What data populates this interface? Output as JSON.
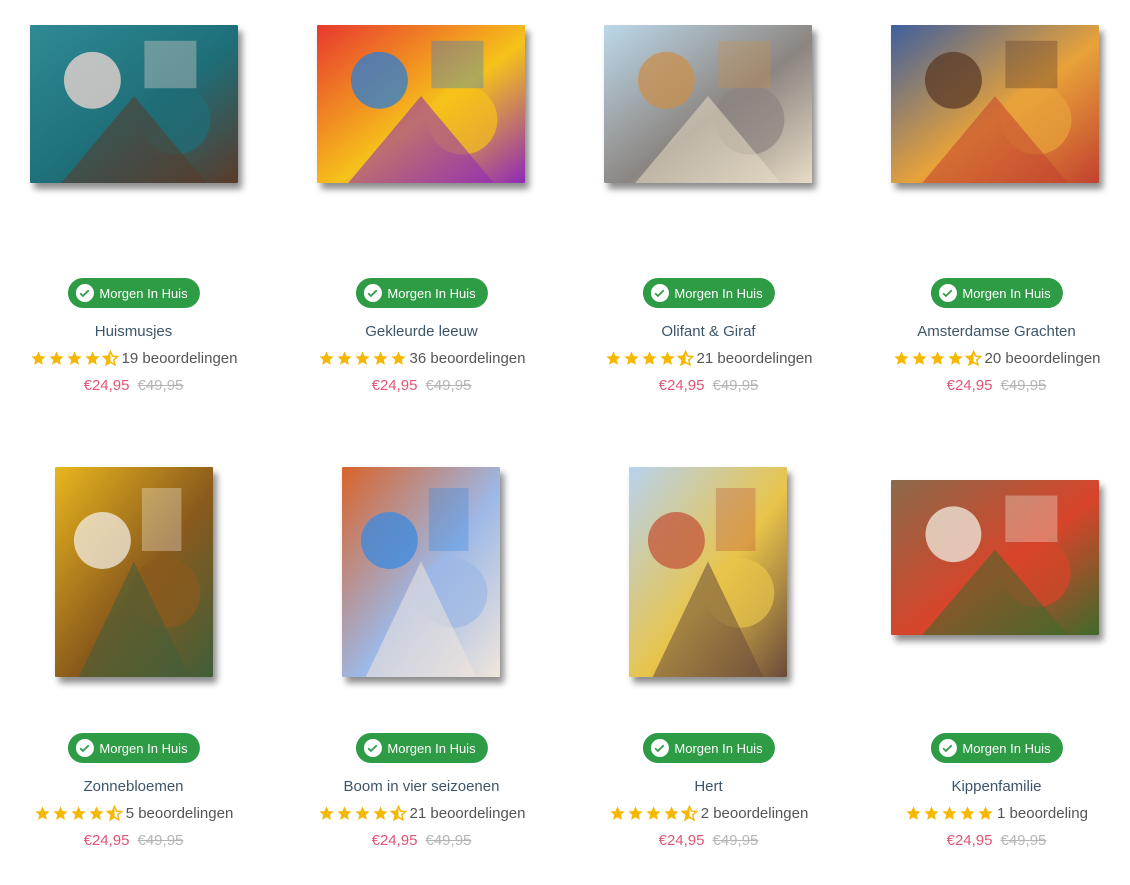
{
  "products": [
    {
      "name": "Huismusjes",
      "badge": "Morgen In Huis",
      "rating": 4.5,
      "reviews": "19 beoordelingen",
      "price": "€24,95",
      "old_price": "€49,95",
      "artwork": "birds-blossom-painting",
      "palette": [
        "#2f8a94",
        "#1e6e78",
        "#f1d9d3",
        "#5a3a2a"
      ]
    },
    {
      "name": "Gekleurde leeuw",
      "badge": "Morgen In Huis",
      "rating": 5,
      "reviews": "36 beoordelingen",
      "price": "€24,95",
      "old_price": "€49,95",
      "artwork": "colorful-lion-painting",
      "palette": [
        "#e8382f",
        "#f6c21a",
        "#2a7fd4",
        "#8e2ab8"
      ]
    },
    {
      "name": "Olifant & Giraf",
      "badge": "Morgen In Huis",
      "rating": 4.5,
      "reviews": "21 beoordelingen",
      "price": "€24,95",
      "old_price": "€49,95",
      "artwork": "elephant-giraffe-painting",
      "palette": [
        "#bcd8ea",
        "#8c8580",
        "#c98f4d",
        "#e8dcc6"
      ]
    },
    {
      "name": "Amsterdamse Grachten",
      "badge": "Morgen In Huis",
      "rating": 4.5,
      "reviews": "20 beoordelingen",
      "price": "€24,95",
      "old_price": "€49,95",
      "artwork": "amsterdam-canal-painting",
      "palette": [
        "#3e5f9e",
        "#e8a23a",
        "#5b3a26",
        "#c2412f"
      ]
    },
    {
      "name": "Zonnebloemen",
      "badge": "Morgen In Huis",
      "rating": 4.5,
      "reviews": "5 beoordelingen",
      "price": "€24,95",
      "old_price": "€49,95",
      "artwork": "sunflowers-painting",
      "palette": [
        "#e9b61e",
        "#8a5a1c",
        "#f1ece0",
        "#3f5e3a"
      ]
    },
    {
      "name": "Boom in vier seizoenen",
      "badge": "Morgen In Huis",
      "rating": 4.5,
      "reviews": "21 beoordelingen",
      "price": "€24,95",
      "old_price": "€49,95",
      "artwork": "four-seasons-tree-painting",
      "palette": [
        "#d9632a",
        "#9db8e6",
        "#3a8ae0",
        "#f0e6dc"
      ]
    },
    {
      "name": "Hert",
      "badge": "Morgen In Huis",
      "rating": 4.5,
      "reviews": "2 beoordelingen",
      "price": "€24,95",
      "old_price": "€49,95",
      "artwork": "geometric-deer-painting",
      "palette": [
        "#b8d2ee",
        "#e8c44a",
        "#c4553a",
        "#6a4a3a"
      ]
    },
    {
      "name": "Kippenfamilie",
      "badge": "Morgen In Huis",
      "rating": 5,
      "reviews": "1 beoordeling",
      "price": "€24,95",
      "old_price": "€49,95",
      "artwork": "chicken-family-painting",
      "palette": [
        "#8a6a4a",
        "#d8442a",
        "#f0ecdf",
        "#3e6a2a"
      ]
    }
  ],
  "colors": {
    "badge_bg": "#2e9b45",
    "title": "#3d5568",
    "price": "#e05575",
    "old_price": "#b5b5b5",
    "star": "#f5b700"
  }
}
